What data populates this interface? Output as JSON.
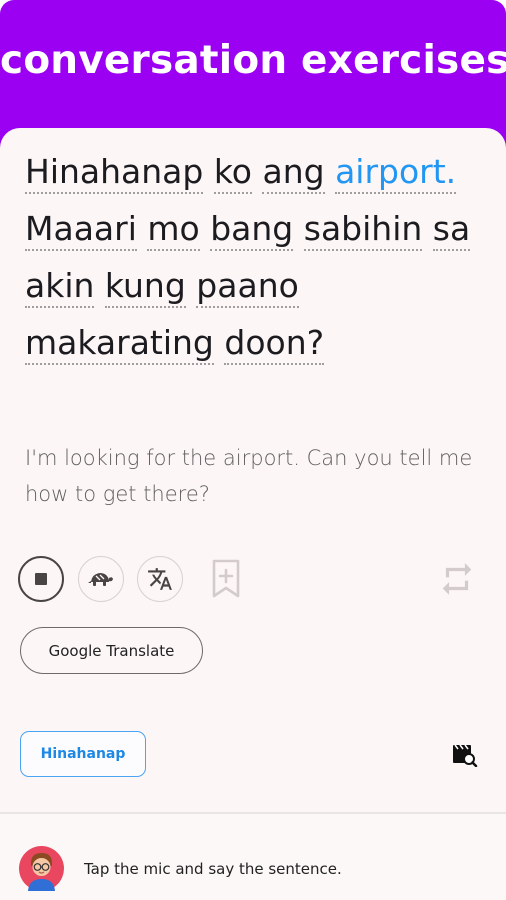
{
  "header": {
    "title": "conversation exercises",
    "color": "#9b00f2"
  },
  "sentence": {
    "words": [
      {
        "text": "Hinahanap",
        "highlight": false
      },
      {
        "text": "ko",
        "highlight": false
      },
      {
        "text": "ang",
        "highlight": false
      },
      {
        "text": "airport.",
        "highlight": true
      },
      {
        "text": "Maaari",
        "highlight": false
      },
      {
        "text": "mo",
        "highlight": false
      },
      {
        "text": "bang",
        "highlight": false
      },
      {
        "text": "sabihin",
        "highlight": false
      },
      {
        "text": "sa",
        "highlight": false
      },
      {
        "text": "akin",
        "highlight": false
      },
      {
        "text": "kung",
        "highlight": false
      },
      {
        "text": "paano",
        "highlight": false
      },
      {
        "text": "makarating",
        "highlight": false
      },
      {
        "text": "doon?",
        "highlight": false
      }
    ],
    "highlight_color": "#2196f3"
  },
  "translation": "I'm looking for the airport. Can you tell me how to get there?",
  "controls": {
    "stop": "stop-icon",
    "slow": "turtle-icon",
    "translate": "translate-icon",
    "bookmark": "bookmark-add-icon",
    "repeat": "repeat-icon"
  },
  "google_translate_label": "Google Translate",
  "word_chip": "Hinahanap",
  "video_search_icon": "video-search-icon",
  "bottom": {
    "avatar": "avatar-icon",
    "instruction": "Tap the mic and say the sentence."
  }
}
